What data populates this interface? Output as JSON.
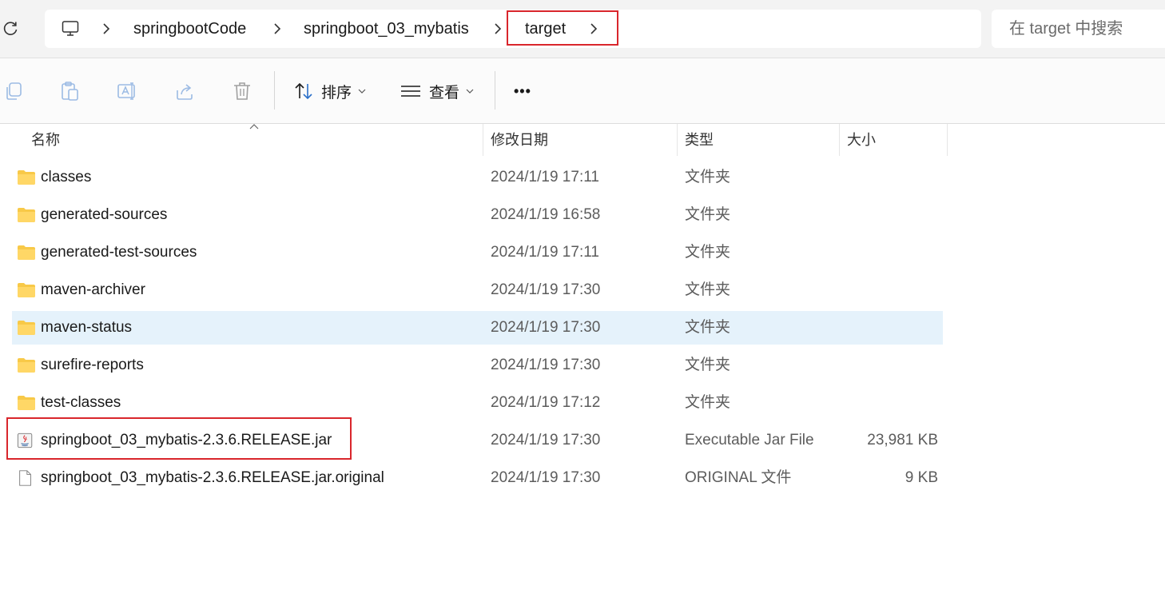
{
  "breadcrumb": {
    "items": [
      {
        "label": "springbootCode"
      },
      {
        "label": "springboot_03_mybatis"
      },
      {
        "label": "target"
      }
    ]
  },
  "search": {
    "placeholder": "在 target 中搜索"
  },
  "toolbar": {
    "sort_label": "排序",
    "view_label": "查看",
    "more_label": "•••"
  },
  "columns": {
    "name": "名称",
    "date": "修改日期",
    "type": "类型",
    "size": "大小"
  },
  "files": [
    {
      "name": "classes",
      "date": "2024/1/19 17:11",
      "type": "文件夹",
      "size": "",
      "icon": "folder-icon"
    },
    {
      "name": "generated-sources",
      "date": "2024/1/19 16:58",
      "type": "文件夹",
      "size": "",
      "icon": "folder-icon"
    },
    {
      "name": "generated-test-sources",
      "date": "2024/1/19 17:11",
      "type": "文件夹",
      "size": "",
      "icon": "folder-icon"
    },
    {
      "name": "maven-archiver",
      "date": "2024/1/19 17:30",
      "type": "文件夹",
      "size": "",
      "icon": "folder-icon"
    },
    {
      "name": "maven-status",
      "date": "2024/1/19 17:30",
      "type": "文件夹",
      "size": "",
      "icon": "folder-icon"
    },
    {
      "name": "surefire-reports",
      "date": "2024/1/19 17:30",
      "type": "文件夹",
      "size": "",
      "icon": "folder-icon"
    },
    {
      "name": "test-classes",
      "date": "2024/1/19 17:12",
      "type": "文件夹",
      "size": "",
      "icon": "folder-icon"
    },
    {
      "name": "springboot_03_mybatis-2.3.6.RELEASE.jar",
      "date": "2024/1/19 17:30",
      "type": "Executable Jar File",
      "size": "23,981 KB",
      "icon": "java-jar-icon"
    },
    {
      "name": "springboot_03_mybatis-2.3.6.RELEASE.jar.original",
      "date": "2024/1/19 17:30",
      "type": "ORIGINAL 文件",
      "size": "9 KB",
      "icon": "document-icon"
    }
  ],
  "colors": {
    "highlight_border": "#d9262c",
    "selected_row": "#e5f2fb",
    "folder": "#f8c948"
  }
}
